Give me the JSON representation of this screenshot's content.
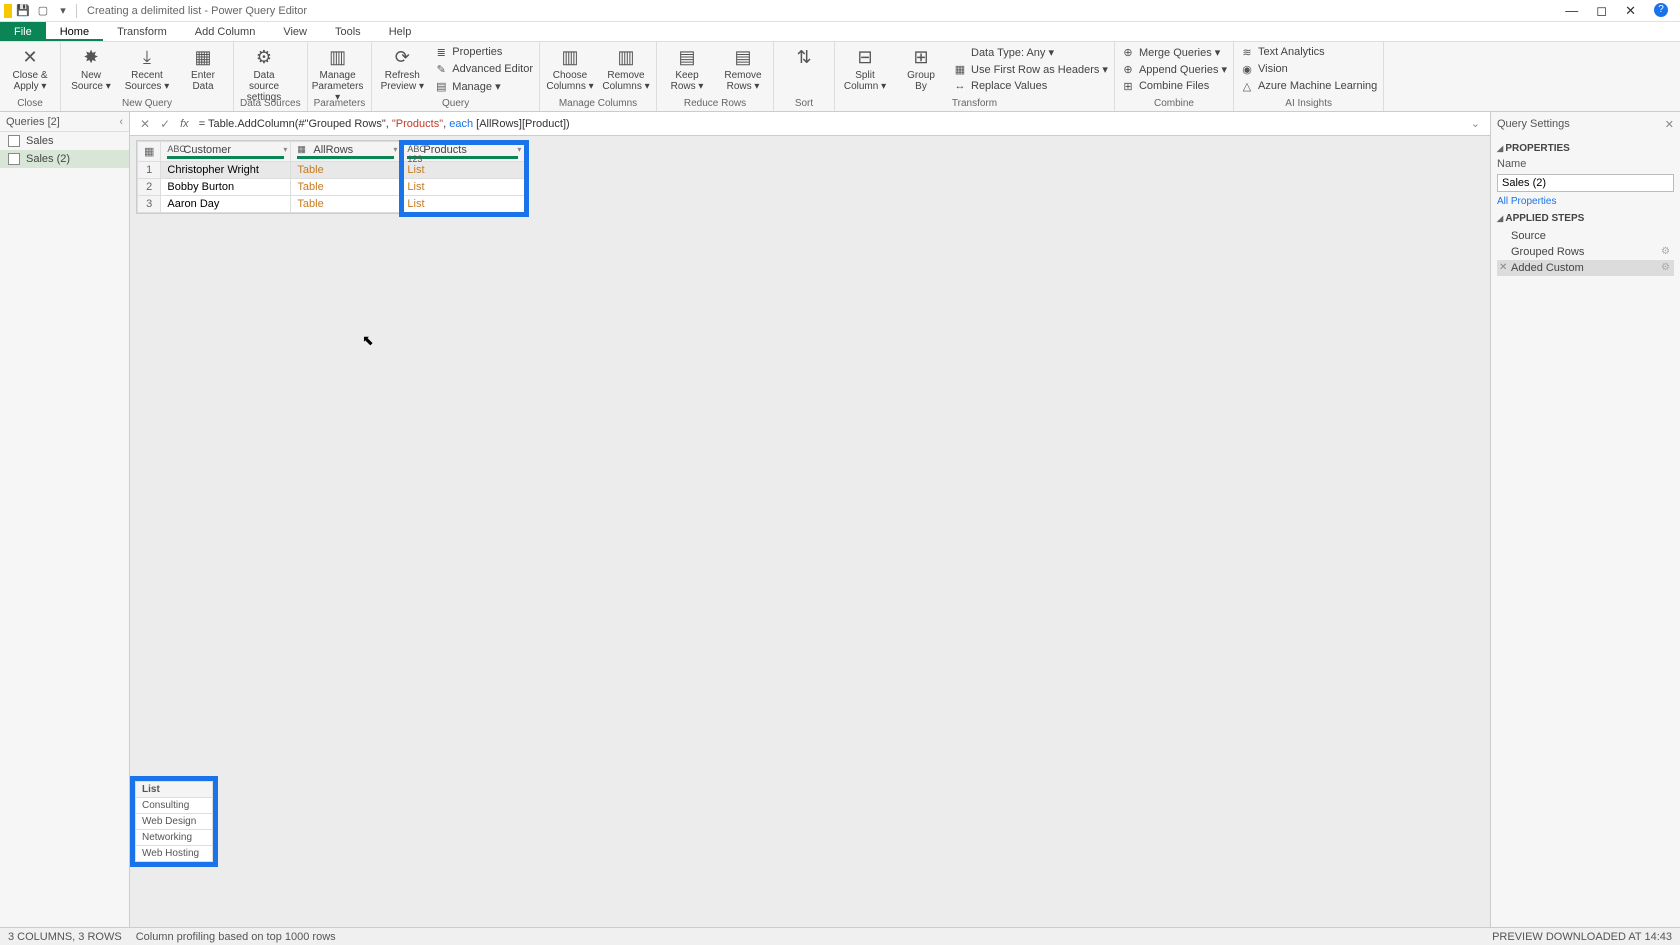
{
  "titlebar": {
    "title": "Creating a delimited list - Power Query Editor"
  },
  "menutabs": [
    "File",
    "Home",
    "Transform",
    "Add Column",
    "View",
    "Tools",
    "Help"
  ],
  "menutab_active": 1,
  "ribbon": {
    "groups": [
      {
        "label": "Close",
        "big": [
          {
            "ico": "✕",
            "lbl": "Close &\nApply ▾"
          }
        ]
      },
      {
        "label": "New Query",
        "big": [
          {
            "ico": "✸",
            "lbl": "New\nSource ▾"
          },
          {
            "ico": "⤓",
            "lbl": "Recent\nSources ▾"
          },
          {
            "ico": "▦",
            "lbl": "Enter\nData"
          }
        ]
      },
      {
        "label": "Data Sources",
        "big": [
          {
            "ico": "⚙",
            "lbl": "Data source\nsettings"
          }
        ]
      },
      {
        "label": "Parameters",
        "big": [
          {
            "ico": "▥",
            "lbl": "Manage\nParameters ▾"
          }
        ]
      },
      {
        "label": "Query",
        "big": [
          {
            "ico": "⟳",
            "lbl": "Refresh\nPreview ▾"
          }
        ],
        "small": [
          {
            "ico": "≣",
            "lbl": "Properties"
          },
          {
            "ico": "✎",
            "lbl": "Advanced Editor"
          },
          {
            "ico": "▤",
            "lbl": "Manage ▾"
          }
        ]
      },
      {
        "label": "Manage Columns",
        "big": [
          {
            "ico": "▥",
            "lbl": "Choose\nColumns ▾"
          },
          {
            "ico": "▥",
            "lbl": "Remove\nColumns ▾"
          }
        ]
      },
      {
        "label": "Reduce Rows",
        "big": [
          {
            "ico": "▤",
            "lbl": "Keep\nRows ▾"
          },
          {
            "ico": "▤",
            "lbl": "Remove\nRows ▾"
          }
        ]
      },
      {
        "label": "Sort",
        "big": [
          {
            "ico": "⇅",
            "lbl": ""
          }
        ]
      },
      {
        "label": "Transform",
        "big": [
          {
            "ico": "⊟",
            "lbl": "Split\nColumn ▾"
          },
          {
            "ico": "⊞",
            "lbl": "Group\nBy"
          }
        ],
        "small": [
          {
            "ico": "",
            "lbl": "Data Type: Any ▾"
          },
          {
            "ico": "▦",
            "lbl": "Use First Row as Headers ▾"
          },
          {
            "ico": "↔",
            "lbl": "Replace Values"
          }
        ]
      },
      {
        "label": "Combine",
        "small": [
          {
            "ico": "⊕",
            "lbl": "Merge Queries ▾"
          },
          {
            "ico": "⊕",
            "lbl": "Append Queries ▾"
          },
          {
            "ico": "⊞",
            "lbl": "Combine Files"
          }
        ]
      },
      {
        "label": "AI Insights",
        "small": [
          {
            "ico": "≋",
            "lbl": "Text Analytics"
          },
          {
            "ico": "◉",
            "lbl": "Vision"
          },
          {
            "ico": "△",
            "lbl": "Azure Machine Learning"
          }
        ]
      }
    ]
  },
  "queries": {
    "header": "Queries [2]",
    "items": [
      {
        "name": "Sales",
        "active": false
      },
      {
        "name": "Sales (2)",
        "active": true
      }
    ]
  },
  "formula_parts": {
    "prefix": "= Table.AddColumn(#\"Grouped Rows\", ",
    "str": "\"Products\"",
    "mid": ", ",
    "kw": "each",
    "suffix": " [AllRows][Product])"
  },
  "grid": {
    "columns": [
      {
        "type": "ABC",
        "name": "Customer"
      },
      {
        "type": "▦",
        "name": "AllRows"
      },
      {
        "type": "ABC\n123",
        "name": "Products",
        "highlight": true
      }
    ],
    "rows": [
      {
        "n": 1,
        "c": [
          "Christopher Wright",
          "Table",
          "List"
        ],
        "sel": true
      },
      {
        "n": 2,
        "c": [
          "Bobby Burton",
          "Table",
          "List"
        ],
        "sel": false
      },
      {
        "n": 3,
        "c": [
          "Aaron Day",
          "Table",
          "List"
        ],
        "sel": false
      }
    ]
  },
  "preview": {
    "header": "List",
    "rows": [
      "Consulting",
      "Web Design",
      "Networking",
      "Web Hosting"
    ]
  },
  "qs": {
    "title": "Query Settings",
    "props_hd": "PROPERTIES",
    "name_lbl": "Name",
    "name_val": "Sales (2)",
    "all_props": "All Properties",
    "steps_hd": "APPLIED STEPS",
    "steps": [
      {
        "name": "Source",
        "sel": false,
        "gear": false
      },
      {
        "name": "Grouped Rows",
        "sel": false,
        "gear": true
      },
      {
        "name": "Added Custom",
        "sel": true,
        "gear": true,
        "del": true
      }
    ]
  },
  "status": {
    "left1": "3 COLUMNS, 3 ROWS",
    "left2": "Column profiling based on top 1000 rows",
    "right": "PREVIEW DOWNLOADED AT 14:43"
  }
}
